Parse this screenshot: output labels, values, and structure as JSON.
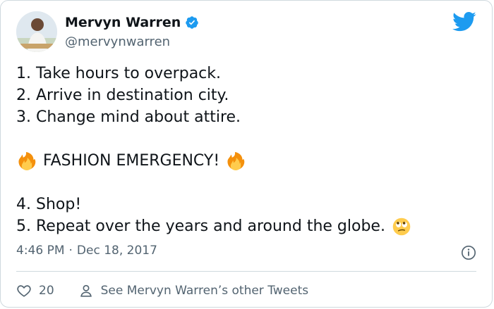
{
  "tweet": {
    "author": {
      "display_name": "Mervyn Warren",
      "handle": "@mervynwarren",
      "verified": true
    },
    "lines": [
      "1. Take hours to overpack.",
      "2. Arrive in destination city.",
      "3. Change mind about attire.",
      "FASHION EMERGENCY!",
      "4. Shop!",
      "5. Repeat over the years and around the globe."
    ],
    "emojis": [
      "fire-emoji",
      "fire-emoji",
      "eye-roll-emoji"
    ],
    "time": "4:46 PM",
    "separator": "·",
    "date": "Dec 18, 2017",
    "like_count": "20",
    "other_tweets_label": "See Mervyn Warren’s other Tweets"
  },
  "icons": {
    "brand": "twitter-bird-icon",
    "verified": "verified-badge-icon",
    "info": "info-icon",
    "like": "heart-icon",
    "profile": "person-icon"
  },
  "colors": {
    "brand_blue": "#1d9bf0",
    "text_primary": "#0f1419",
    "text_secondary": "#536471",
    "border": "#cfd9de",
    "fire_orange": "#f4900c",
    "emoji_yellow": "#ffcc4d"
  }
}
